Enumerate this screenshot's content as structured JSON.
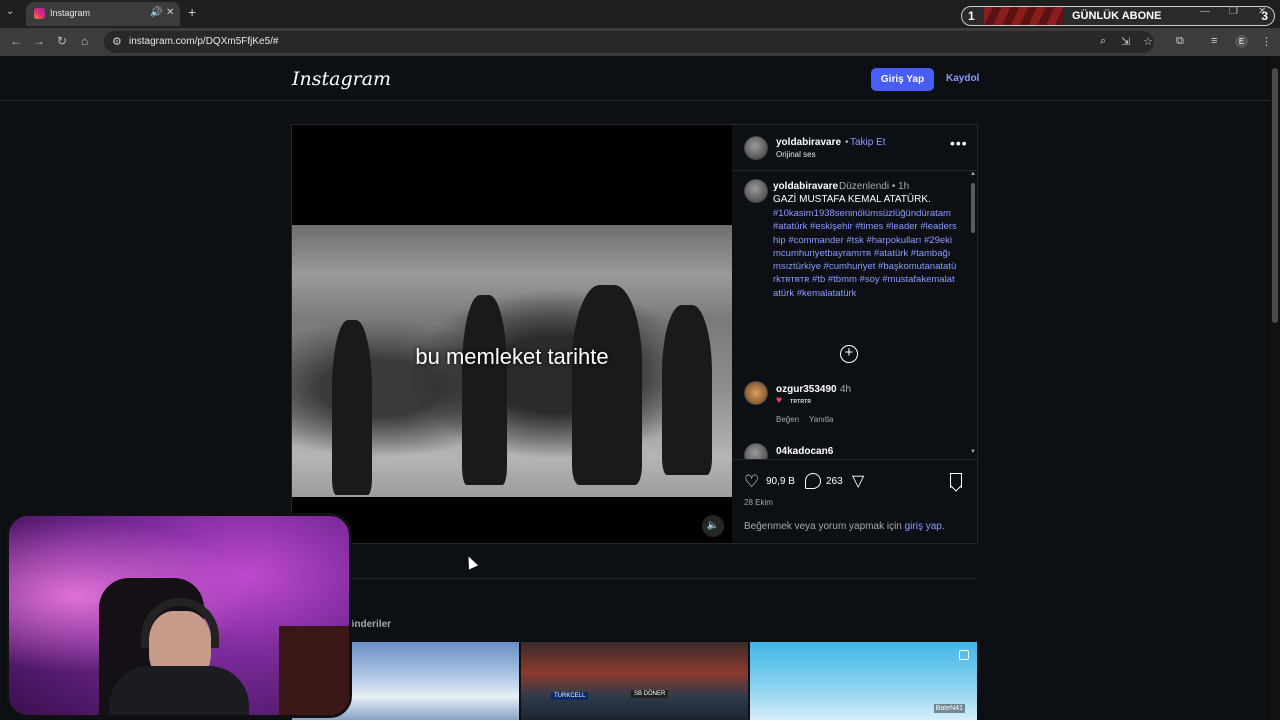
{
  "browser": {
    "tab_title": "Instagram",
    "url": "instagram.com/p/DQXm5FfjKe5/#",
    "profile_initial": "E"
  },
  "overlay_banner": {
    "left_number": "1",
    "label": "GÜNLÜK ABONE",
    "right_number": "3"
  },
  "header": {
    "logo": "Instagram",
    "login_label": "Giriş Yap",
    "signup_label": "Kaydol"
  },
  "video": {
    "subtitle": "bu memleket tarihte"
  },
  "post": {
    "username": "yoldabiravare",
    "separator": "•",
    "follow_label": "Takip Et",
    "audio": "Orijinal ses",
    "caption": {
      "username": "yoldabiravare",
      "edited": "Düzenlendi •  1h",
      "title": "GAZİ MUSTAFA KEMAL ATATÜRK.",
      "hashtags": "#10kasim1938seninölümsüzlüğündüratam #atatürk #eskişehir #times #leader #leadership #commander #tsk #harpokulları #29ekimcumhuriyetbayramıᴛʀ #atatürk #tambağımsıztürkiye #cumhuriyet #başkomutanatatürkᴛʀᴛʀᴛʀ #tb #tbmm #soy #mustafakemalatatürk #kemalatatürk"
    },
    "comments": [
      {
        "username": "ozgur353490",
        "time": "4h",
        "text": "ᴛʀᴛʀᴛʀ",
        "like_label": "Beğen",
        "reply_label": "Yanıtla"
      },
      {
        "username": "04kadocan6"
      }
    ],
    "likes": "90,9 B",
    "comment_count": "263",
    "date": "28 Ekim",
    "login_prompt_text": "Beğenmek veya yorum yapmak için ",
    "login_prompt_link": "giriş yap",
    "login_prompt_end": "."
  },
  "more_posts": {
    "title": "'dan diğer gönderiler",
    "thumb2_sign_left": "TURKCELL",
    "thumb2_sign_right": "SB DÖNER",
    "thumb3_watermark": "BateN41"
  },
  "icons": [
    "search-icon",
    "heart-icon",
    "comment-icon",
    "share-icon",
    "bookmark-icon",
    "more-icon",
    "speaker-icon",
    "plus-circle-icon"
  ],
  "colors": {
    "accent": "#4a5df9",
    "link": "#8d9bff",
    "bg": "#0c1014"
  }
}
